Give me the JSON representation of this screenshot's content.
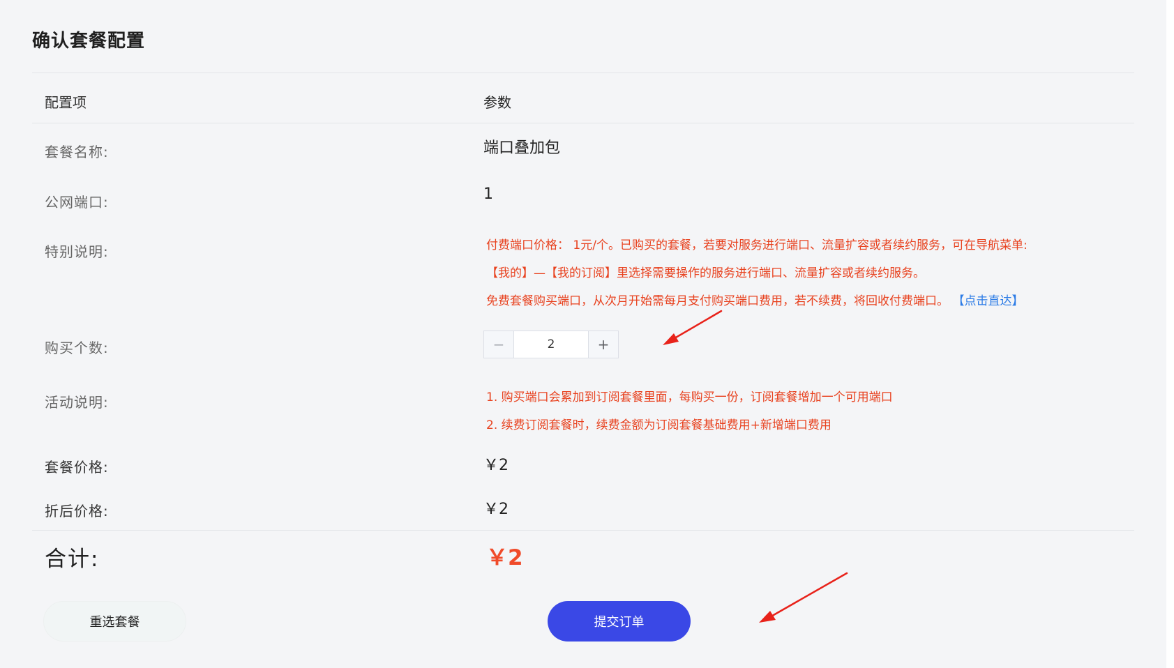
{
  "page_title": "确认套餐配置",
  "table_header": {
    "label_col": "配置项",
    "value_col": "参数"
  },
  "rows": {
    "package_name": {
      "label": "套餐名称:",
      "value": "端口叠加包"
    },
    "public_ports": {
      "label": "公网端口:",
      "value": "1"
    },
    "special_notes": {
      "label": "特别说明:",
      "lines": [
        "付费端口价格： 1元/个。已购买的套餐，若要对服务进行端口、流量扩容或者续约服务，可在导航菜单:",
        "【我的】—【我的订阅】里选择需要操作的服务进行端口、流量扩容或者续约服务。",
        "免费套餐购买端口，从次月开始需每月支付购买端口费用，若不续费，将回收付费端口。"
      ],
      "link": "【点击直达】"
    },
    "quantity": {
      "label": "购买个数:",
      "value": "2",
      "minus": "−",
      "plus": "+"
    },
    "activity_notes": {
      "label": "活动说明:",
      "lines": [
        "1. 购买端口会累加到订阅套餐里面，每购买一份，订阅套餐增加一个可用端口",
        "2. 续费订阅套餐时，续费金额为订阅套餐基础费用+新增端口费用"
      ]
    },
    "package_price": {
      "label": "套餐价格:",
      "value": "￥2"
    },
    "discount_price": {
      "label": "折后价格:",
      "value": "￥2"
    }
  },
  "total": {
    "label": "合计:",
    "value": "￥2"
  },
  "buttons": {
    "reselect": "重选套餐",
    "submit": "提交订单"
  },
  "colors": {
    "accent_red": "#e8421f",
    "link_blue": "#2b7be6",
    "submit_blue": "#3a48e6",
    "annotation_arrow": "#e8221a"
  }
}
